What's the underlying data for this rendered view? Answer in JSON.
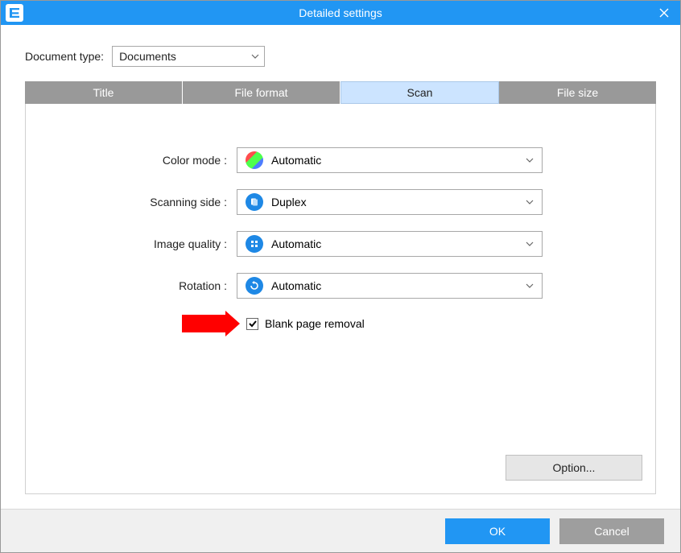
{
  "window": {
    "title": "Detailed settings"
  },
  "document_type": {
    "label": "Document type:",
    "value": "Documents"
  },
  "tabs": {
    "title": "Title",
    "file_format": "File format",
    "scan": "Scan",
    "file_size": "File size"
  },
  "scan": {
    "color_mode": {
      "label": "Color mode  :",
      "value": "Automatic",
      "icon": "auto-color-icon"
    },
    "scanning_side": {
      "label": "Scanning side  :",
      "value": "Duplex",
      "icon": "duplex-icon"
    },
    "image_quality": {
      "label": "Image quality  :",
      "value": "Automatic",
      "icon": "quality-auto-icon"
    },
    "rotation": {
      "label": "Rotation  :",
      "value": "Automatic",
      "icon": "rotation-auto-icon"
    },
    "blank_page_removal": {
      "label": "Blank page removal",
      "checked": true
    }
  },
  "buttons": {
    "option": "Option...",
    "ok": "OK",
    "cancel": "Cancel"
  },
  "colors": {
    "accent": "#2196f3",
    "tab_inactive": "#999999",
    "tab_active": "#cce4ff",
    "arrow": "#ff0000"
  }
}
